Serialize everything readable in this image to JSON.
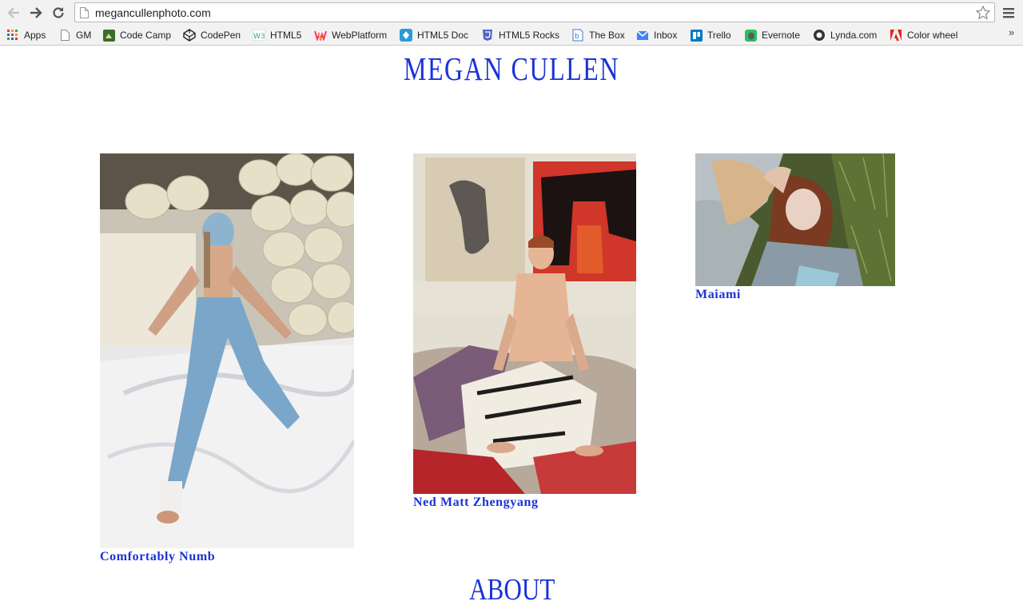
{
  "browser": {
    "url": "megancullenphoto.com",
    "bookmarks": [
      {
        "label": "Apps",
        "icon": "apps-grid-icon"
      },
      {
        "label": "GM",
        "icon": "page-icon"
      },
      {
        "label": "Code Camp",
        "icon": "code-camp-icon"
      },
      {
        "label": "CodePen",
        "icon": "codepen-icon"
      },
      {
        "label": "HTML5",
        "icon": "w3schools-icon"
      },
      {
        "label": "WebPlatform",
        "icon": "webplatform-icon"
      },
      {
        "label": "HTML5 Doc",
        "icon": "html5-doc-icon"
      },
      {
        "label": "HTML5 Rocks",
        "icon": "html5-shield-icon"
      },
      {
        "label": "The Box",
        "icon": "box-icon"
      },
      {
        "label": "Inbox",
        "icon": "inbox-icon"
      },
      {
        "label": "Trello",
        "icon": "trello-icon"
      },
      {
        "label": "Evernote",
        "icon": "evernote-icon"
      },
      {
        "label": "Lynda.com",
        "icon": "lynda-icon"
      },
      {
        "label": "Color wheel",
        "icon": "adobe-icon"
      }
    ],
    "more_label": "»"
  },
  "site": {
    "title": "MEGAN CULLEN",
    "accent_color": "#1a33d6"
  },
  "works": [
    {
      "caption": "Comfortably Numb"
    },
    {
      "caption": "Ned Matt Zhengyang"
    },
    {
      "caption": "Maiami"
    }
  ],
  "footer": {
    "about_label": "ABOUT"
  }
}
